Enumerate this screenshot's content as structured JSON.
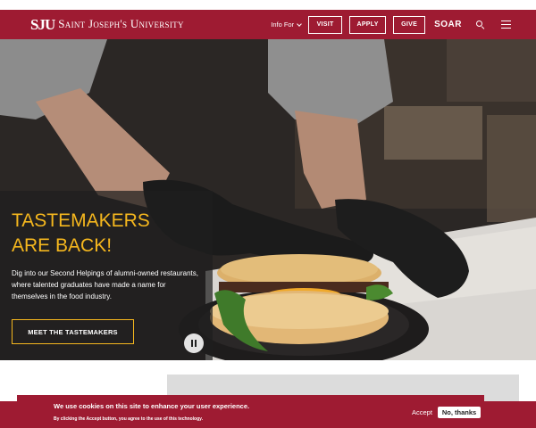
{
  "header": {
    "logo_mark": "SJU",
    "logo_text": "Saint Joseph's University",
    "info_for": "Info For",
    "buttons": {
      "visit": "VISIT",
      "apply": "APPLY",
      "give": "GIVE"
    },
    "soar": "SOAR",
    "search_icon": "search-icon",
    "menu_icon": "hamburger-menu-icon"
  },
  "hero": {
    "title": "TASTEMAKERS ARE BACK!",
    "description": "Dig into our Second Helpings of alumni-owned restaurants, where talented graduates have made a name for themselves in the food industry.",
    "cta_label": "MEET THE TASTEMAKERS",
    "pause_icon": "pause-icon"
  },
  "cookie": {
    "title": "We use cookies on this site to enhance your user experience.",
    "subtitle": "By clicking the Accept button, you agree to the use of this technology.",
    "accept_label": "Accept",
    "decline_label": "No, thanks"
  },
  "colors": {
    "brand_crimson": "#9e1b32",
    "accent_gold": "#f5b71e"
  }
}
